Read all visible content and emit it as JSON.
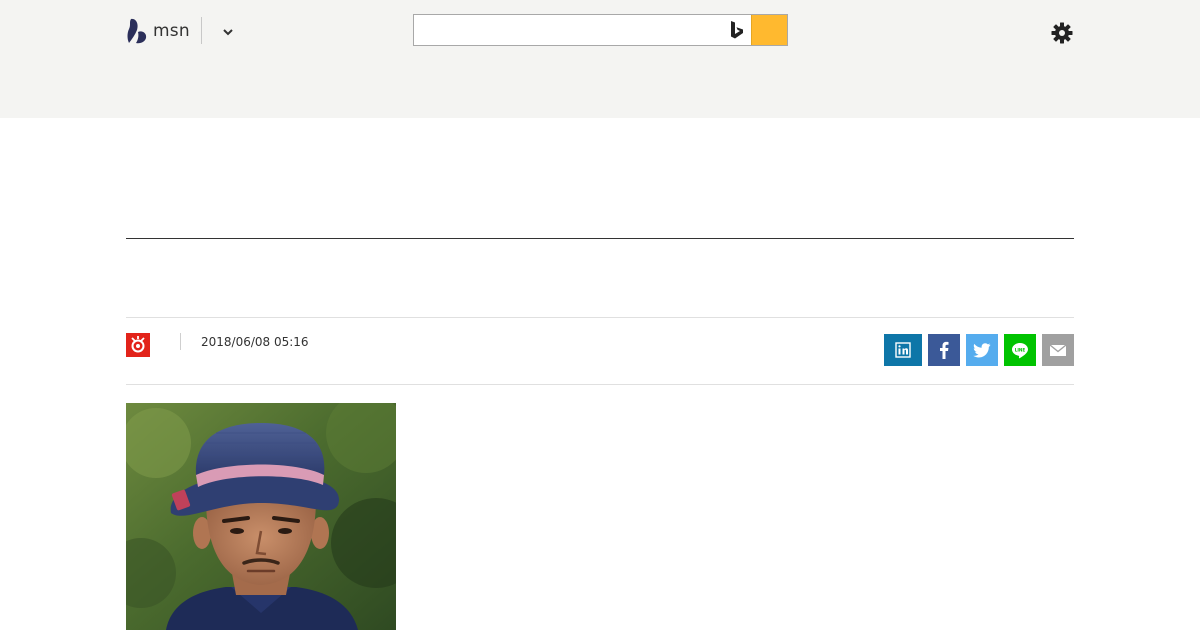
{
  "header": {
    "logo_text": "msn",
    "search": {
      "value": "",
      "placeholder": ""
    },
    "accent_color": "#ffb92f",
    "icons": [
      "msn-butterfly-icon",
      "chevron-down-icon",
      "bing-icon",
      "gear-icon"
    ]
  },
  "article": {
    "timestamp": "2018/06/08 05:16",
    "source_logo_icon": "source-logo-icon",
    "share_buttons": [
      {
        "name": "linkedin",
        "icon": "linkedin-icon",
        "color": "#0e76a8"
      },
      {
        "name": "facebook",
        "icon": "facebook-icon",
        "color": "#3b5998"
      },
      {
        "name": "twitter",
        "icon": "twitter-icon",
        "color": "#55acee"
      },
      {
        "name": "line",
        "icon": "line-icon",
        "color": "#00c300"
      },
      {
        "name": "email",
        "icon": "mail-icon",
        "color": "#a0a0a0"
      }
    ],
    "photo_icon": "article-photo"
  }
}
